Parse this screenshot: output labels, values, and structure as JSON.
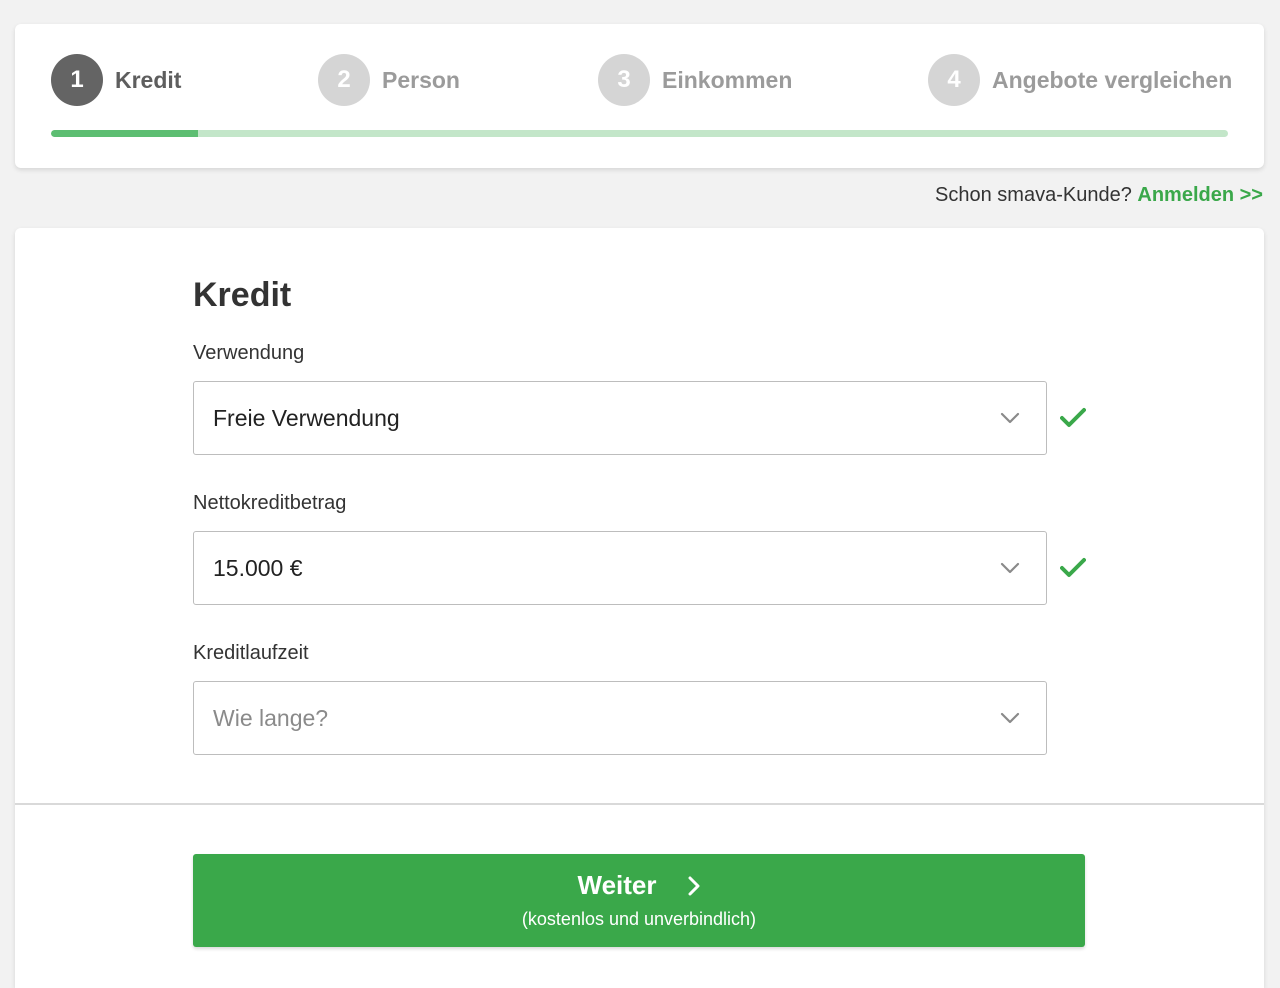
{
  "colors": {
    "accent": "#3aa84a",
    "progress_fill": "#5dbe72",
    "progress_track": "#c3e6c9",
    "step_active": "#646464",
    "step_inactive": "#d5d5d5",
    "label_active": "#5e5e5e",
    "label_inactive": "#9b9b9b",
    "check": "#3aa84a"
  },
  "stepper": {
    "progress": 0.125,
    "steps": [
      {
        "number": "1",
        "label": "Kredit",
        "state": "active"
      },
      {
        "number": "2",
        "label": "Person",
        "state": "upcoming"
      },
      {
        "number": "3",
        "label": "Einkommen",
        "state": "upcoming"
      },
      {
        "number": "4",
        "label": "Angebote vergleichen",
        "state": "upcoming"
      }
    ]
  },
  "login": {
    "prompt": "Schon smava-Kunde?",
    "link": "Anmelden >>"
  },
  "form": {
    "title": "Kredit",
    "fields": [
      {
        "label": "Verwendung",
        "value": "Freie Verwendung",
        "placeholder": "",
        "valid": true,
        "icon": "chevron-down-icon"
      },
      {
        "label": "Nettokreditbetrag",
        "value": "15.000 €",
        "placeholder": "",
        "valid": true,
        "icon": "chevron-down-icon"
      },
      {
        "label": "Kreditlaufzeit",
        "value": "",
        "placeholder": "Wie lange?",
        "valid": false,
        "icon": "chevron-down-icon"
      }
    ]
  },
  "submit": {
    "label": "Weiter",
    "sublabel": "(kostenlos und unverbindlich)",
    "icon": "chevron-right-icon"
  }
}
